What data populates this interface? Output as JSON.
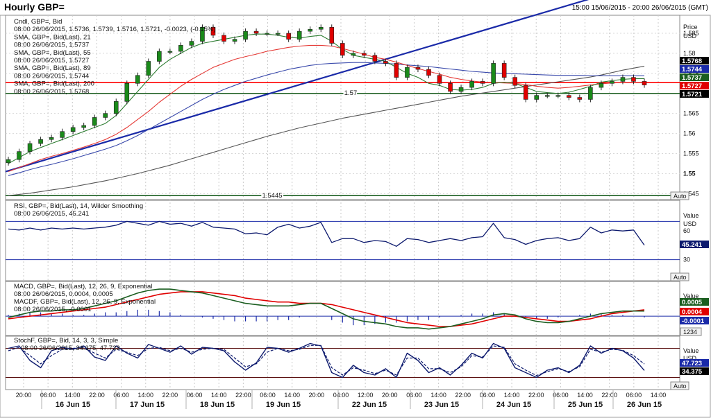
{
  "header": {
    "title": "Hourly GBP=",
    "date_range": "15:00 15/06/2015 - 20:00 26/06/2015 (GMT)"
  },
  "colors": {
    "up": "#1a8a1a",
    "down": "#e00000",
    "sma21": "#2e7d32",
    "sma55": "#e53935",
    "sma89": "#3949ab",
    "sma200": "#555555",
    "trend": "#1a2aa8",
    "resistance": "#ff0000",
    "support": "#1b5e20",
    "rsi": "#0d1a6e",
    "macd": "#1b5e20",
    "macd_signal": "#e00000",
    "stoch_k": "#0d1a6e",
    "stoch_d": "#0d1a6e"
  },
  "main_panel": {
    "legend": [
      {
        "text": "Cndl, GBP=, Bid",
        "color": "#111111"
      },
      {
        "text": "08:00 26/06/2015, 1.5736, 1.5739, 1.5716, 1.5721, -0.0023, (-0.15%)",
        "color": "#e00000"
      },
      {
        "text": "SMA, GBP=, Bid(Last), 21",
        "color": "#111111"
      },
      {
        "text": "08:00 26/06/2015, 1.5737",
        "color": "#1b5e20"
      },
      {
        "text": "SMA, GBP=, Bid(Last), 55",
        "color": "#111111"
      },
      {
        "text": "08:00 26/06/2015, 1.5727",
        "color": "#e00000"
      },
      {
        "text": "SMA, GBP=, Bid(Last), 89",
        "color": "#111111"
      },
      {
        "text": "08:00 26/06/2015, 1.5744",
        "color": "#1a2aa8"
      },
      {
        "text": "SMA, GBP=, Bid(Last), 200",
        "color": "#111111"
      },
      {
        "text": "08:00 26/06/2015, 1.5768",
        "color": "#111111"
      }
    ],
    "axis_title": [
      "Price",
      "USD"
    ],
    "axis_ticks": [
      1.545,
      1.55,
      1.555,
      1.56,
      1.565,
      1.57,
      1.575,
      1.58,
      1.585
    ],
    "level_label_157": "1.57",
    "level_label_15445": "1.5445",
    "price_tags": [
      {
        "text": "1.5768",
        "bg": "#000000",
        "fg": "#ffffff"
      },
      {
        "text": "1.5744",
        "bg": "#1a2aa8",
        "fg": "#ffffff"
      },
      {
        "text": "1.5737",
        "bg": "#1b5e20",
        "fg": "#ffffff"
      },
      {
        "text": "1.5727",
        "bg": "#e00000",
        "fg": "#ffffff"
      },
      {
        "text": "1.5721",
        "bg": "#000000",
        "fg": "#ffffff"
      }
    ],
    "auto": "Auto"
  },
  "rsi_panel": {
    "legend": [
      "RSI, GBP=, Bid(Last), 14, Wilder Smoothing",
      "08:00 26/06/2015, 45.241"
    ],
    "axis_title": [
      "Value",
      "USD"
    ],
    "ticks": [
      30,
      60
    ],
    "tag": "45.241",
    "auto": "Auto"
  },
  "macd_panel": {
    "legend": [
      {
        "text": "MACD, GBP=, Bid(Last), 12, 26, 9, Exponential",
        "color": "#e00000"
      },
      {
        "text": "08:00 26/06/2015, 0.0004, 0.0005",
        "color": "#e00000"
      },
      {
        "text": "MACDF, GBP=, Bid(Last), 12, 26, 9, Exponential",
        "color": "#1a2aa8"
      },
      {
        "text": "08:00 26/06/2015, -0.0001",
        "color": "#1a2aa8"
      }
    ],
    "axis_title": [
      "Value",
      "USD"
    ],
    "tags": [
      {
        "text": "0.0005",
        "bg": "#1b5e20"
      },
      {
        "text": "0.0004",
        "bg": "#e00000"
      },
      {
        "text": "-0.0001",
        "bg": "#1a2aa8"
      }
    ],
    "scale": "1234"
  },
  "stoch_panel": {
    "legend": [
      "StochF, GBP=, Bid, 14, 3, 3, Simple",
      "08:00 26/06/2015, 34.375, 47.723"
    ],
    "axis_title": [
      "Value",
      "USD"
    ],
    "tags": [
      {
        "text": "47.723",
        "bg": "#1a2aa8"
      },
      {
        "text": "34.375",
        "bg": "#000000"
      }
    ],
    "auto": "Auto"
  },
  "time_axis": {
    "hour_labels": [
      "20:00",
      "06:00",
      "14:00",
      "22:00",
      "06:00",
      "14:00",
      "22:00",
      "06:00",
      "14:00",
      "22:00",
      "06:00",
      "14:00",
      "20:00",
      "04:00",
      "12:00",
      "20:00",
      "06:00",
      "14:00",
      "22:00",
      "06:00",
      "14:00",
      "22:00",
      "06:00",
      "14:00",
      "22:00",
      "06:00",
      "14:00"
    ],
    "day_labels": [
      "16 Jun 15",
      "17 Jun 15",
      "18 Jun 15",
      "19 Jun 15",
      "22 Jun 15",
      "23 Jun 15",
      "24 Jun 15",
      "25 Jun 15",
      "26 Jun 15"
    ]
  },
  "chart_data": {
    "type": "line",
    "title": "Hourly GBP=",
    "x_range": [
      "15:00 15/06/2015",
      "20:00 26/06/2015"
    ],
    "ylim": [
      1.5435,
      1.5895
    ],
    "y_ticks": [
      1.545,
      1.55,
      1.555,
      1.56,
      1.565,
      1.57,
      1.575,
      1.58,
      1.585
    ],
    "grid": true,
    "series": [
      {
        "name": "GBP= Bid",
        "kind": "close",
        "values": [
          1.5535,
          1.5555,
          1.5575,
          1.5585,
          1.559,
          1.5605,
          1.5615,
          1.562,
          1.564,
          1.565,
          1.568,
          1.5725,
          1.5745,
          1.578,
          1.5805,
          1.5805,
          1.582,
          1.583,
          1.5865,
          1.5845,
          1.583,
          1.5835,
          1.5855,
          1.585,
          1.585,
          1.585,
          1.5835,
          1.5855,
          1.586,
          1.5865,
          1.5825,
          1.5795,
          1.58,
          1.5795,
          1.578,
          1.5775,
          1.574,
          1.5765,
          1.576,
          1.5745,
          1.5725,
          1.5705,
          1.5715,
          1.573,
          1.5725,
          1.5775,
          1.574,
          1.572,
          1.5685,
          1.5695,
          1.5695,
          1.5695,
          1.569,
          1.5685,
          1.5715,
          1.5725,
          1.573,
          1.574,
          1.573,
          1.5721
        ]
      },
      {
        "name": "SMA 21",
        "values": [
          1.5525,
          1.554,
          1.5555,
          1.5565,
          1.5575,
          1.5585,
          1.5595,
          1.5605,
          1.5615,
          1.5625,
          1.5645,
          1.5675,
          1.5705,
          1.5735,
          1.5765,
          1.5785,
          1.58,
          1.5815,
          1.5825,
          1.583,
          1.5835,
          1.584,
          1.5845,
          1.5848,
          1.5848,
          1.5845,
          1.584,
          1.5838,
          1.5842,
          1.5845,
          1.583,
          1.581,
          1.5795,
          1.579,
          1.5785,
          1.578,
          1.5765,
          1.575,
          1.574,
          1.5725,
          1.572,
          1.571,
          1.5708,
          1.571,
          1.5715,
          1.5725,
          1.5728,
          1.5725,
          1.5715,
          1.5705,
          1.5702,
          1.57,
          1.5703,
          1.571,
          1.5718,
          1.5728,
          1.5732,
          1.5735,
          1.5737,
          1.5737
        ]
      },
      {
        "name": "SMA 55",
        "values": [
          1.5505,
          1.5515,
          1.5525,
          1.5535,
          1.5543,
          1.555,
          1.5558,
          1.5566,
          1.5575,
          1.5585,
          1.5598,
          1.5615,
          1.5635,
          1.5655,
          1.5678,
          1.5698,
          1.5718,
          1.5735,
          1.575,
          1.5765,
          1.5775,
          1.5785,
          1.5792,
          1.5798,
          1.5805,
          1.581,
          1.5815,
          1.5818,
          1.582,
          1.582,
          1.5818,
          1.5812,
          1.5805,
          1.5798,
          1.579,
          1.5785,
          1.5778,
          1.577,
          1.5762,
          1.5755,
          1.5748,
          1.574,
          1.5735,
          1.5731,
          1.5728,
          1.5727,
          1.5726,
          1.5725,
          1.5722,
          1.5718,
          1.5715,
          1.5713,
          1.5715,
          1.5718,
          1.5721,
          1.5724,
          1.5726,
          1.5727,
          1.5727,
          1.5727
        ]
      },
      {
        "name": "SMA 89",
        "values": [
          1.5495,
          1.5502,
          1.551,
          1.5517,
          1.5523,
          1.553,
          1.5537,
          1.5545,
          1.5553,
          1.5561,
          1.557,
          1.5582,
          1.5595,
          1.561,
          1.5625,
          1.564,
          1.5655,
          1.567,
          1.5685,
          1.5698,
          1.571,
          1.572,
          1.573,
          1.5738,
          1.5746,
          1.5753,
          1.576,
          1.5765,
          1.577,
          1.5773,
          1.5775,
          1.5776,
          1.5777,
          1.5777,
          1.5776,
          1.5775,
          1.5773,
          1.5771,
          1.5769,
          1.5767,
          1.5764,
          1.5761,
          1.5758,
          1.5755,
          1.5753,
          1.5751,
          1.575,
          1.5749,
          1.5748,
          1.5747,
          1.5746,
          1.5745,
          1.5745,
          1.5745,
          1.5744,
          1.5744,
          1.5744,
          1.5744,
          1.5744,
          1.5744
        ]
      },
      {
        "name": "SMA 200",
        "values": [
          1.5445,
          1.5448,
          1.5451,
          1.5455,
          1.5459,
          1.5463,
          1.5467,
          1.5472,
          1.5477,
          1.5482,
          1.5488,
          1.5494,
          1.55,
          1.5507,
          1.5514,
          1.5521,
          1.5529,
          1.5537,
          1.5545,
          1.5553,
          1.5561,
          1.5569,
          1.5577,
          1.5585,
          1.5593,
          1.56,
          1.5607,
          1.5614,
          1.562,
          1.5626,
          1.5632,
          1.5638,
          1.5643,
          1.5648,
          1.5653,
          1.5658,
          1.5663,
          1.5668,
          1.5673,
          1.5678,
          1.5683,
          1.5688,
          1.5693,
          1.5697,
          1.5701,
          1.5705,
          1.5709,
          1.5713,
          1.5717,
          1.5721,
          1.5725,
          1.5729,
          1.5733,
          1.5737,
          1.5741,
          1.5746,
          1.5752,
          1.5758,
          1.5763,
          1.5768
        ]
      },
      {
        "name": "RSI 14",
        "values": [
          62,
          61,
          63,
          61,
          63,
          62,
          63,
          62,
          63,
          64,
          66,
          70,
          68,
          66,
          70,
          67,
          68,
          65,
          69,
          64,
          63,
          62,
          57,
          58,
          56,
          64,
          67,
          63,
          65,
          69,
          48,
          52,
          52,
          48,
          50,
          49,
          44,
          52,
          51,
          48,
          50,
          52,
          50,
          53,
          54,
          68,
          53,
          51,
          46,
          50,
          52,
          53,
          50,
          52,
          64,
          58,
          61,
          60,
          61,
          45.241
        ]
      },
      {
        "name": "MACD",
        "values": [
          -0.0001,
          0.0001,
          0.0003,
          0.0004,
          0.0004,
          0.0005,
          0.0005,
          0.0006,
          0.0008,
          0.001,
          0.0012,
          0.0015,
          0.0018,
          0.002,
          0.0021,
          0.0021,
          0.002,
          0.0019,
          0.0018,
          0.0016,
          0.0014,
          0.0012,
          0.001,
          0.0009,
          0.0008,
          0.0008,
          0.0008,
          0.0009,
          0.001,
          0.001,
          0.0006,
          0.0002,
          -0.0002,
          -0.0004,
          -0.0005,
          -0.0006,
          -0.0008,
          -0.0009,
          -0.0009,
          -0.001,
          -0.0009,
          -0.0008,
          -0.0006,
          -0.0004,
          -0.0002,
          0.0001,
          0.0002,
          0.0001,
          -0.0002,
          -0.0004,
          -0.0005,
          -0.0005,
          -0.0004,
          -0.0002,
          0,
          0.0002,
          0.0003,
          0.0004,
          0.0004,
          0.0004
        ]
      },
      {
        "name": "MACD Signal",
        "values": [
          -0.0002,
          -0.0001,
          0,
          0.0001,
          0.0002,
          0.0003,
          0.0004,
          0.0005,
          0.0006,
          0.0007,
          0.0009,
          0.0011,
          0.0013,
          0.0015,
          0.0017,
          0.0018,
          0.0019,
          0.0019,
          0.0019,
          0.0018,
          0.0017,
          0.0016,
          0.0014,
          0.0013,
          0.0012,
          0.0011,
          0.0011,
          0.001,
          0.001,
          0.001,
          0.0009,
          0.0007,
          0.0005,
          0.0003,
          0.0001,
          -0.0001,
          -0.0003,
          -0.0005,
          -0.0006,
          -0.0007,
          -0.0008,
          -0.0008,
          -0.0007,
          -0.0006,
          -0.0004,
          -0.0002,
          0,
          0,
          -0.0001,
          -0.0002,
          -0.0003,
          -0.0004,
          -0.0004,
          -0.0003,
          -0.0002,
          0,
          0.0002,
          0.0003,
          0.0004,
          0.0005
        ]
      },
      {
        "name": "StochF %K",
        "values": [
          80,
          85,
          55,
          40,
          75,
          82,
          78,
          85,
          62,
          55,
          85,
          70,
          60,
          88,
          80,
          72,
          85,
          68,
          82,
          80,
          75,
          52,
          35,
          50,
          82,
          80,
          72,
          80,
          90,
          85,
          30,
          20,
          45,
          30,
          25,
          38,
          20,
          70,
          55,
          30,
          40,
          25,
          45,
          70,
          60,
          90,
          80,
          40,
          30,
          20,
          35,
          40,
          30,
          45,
          85,
          70,
          80,
          75,
          60,
          34.375
        ]
      },
      {
        "name": "StochF %D",
        "values": [
          75,
          82,
          65,
          48,
          65,
          78,
          80,
          82,
          70,
          60,
          78,
          72,
          65,
          80,
          82,
          75,
          80,
          72,
          78,
          80,
          78,
          60,
          42,
          48,
          72,
          80,
          75,
          78,
          86,
          86,
          40,
          25,
          40,
          35,
          28,
          35,
          25,
          60,
          60,
          38,
          38,
          30,
          42,
          65,
          62,
          85,
          82,
          48,
          35,
          24,
          32,
          38,
          32,
          42,
          78,
          72,
          78,
          76,
          65,
          47.723
        ]
      }
    ],
    "levels": [
      {
        "value": 1.5727,
        "color": "red"
      },
      {
        "value": 1.57,
        "color": "green",
        "label": "1.57"
      },
      {
        "value": 1.5445,
        "color": "green",
        "label": "1.5445"
      }
    ],
    "trendline": {
      "from": [
        "15:00 15/06/2015",
        1.5505
      ],
      "to": [
        "20:00 26/06/2015",
        1.598
      ]
    }
  }
}
